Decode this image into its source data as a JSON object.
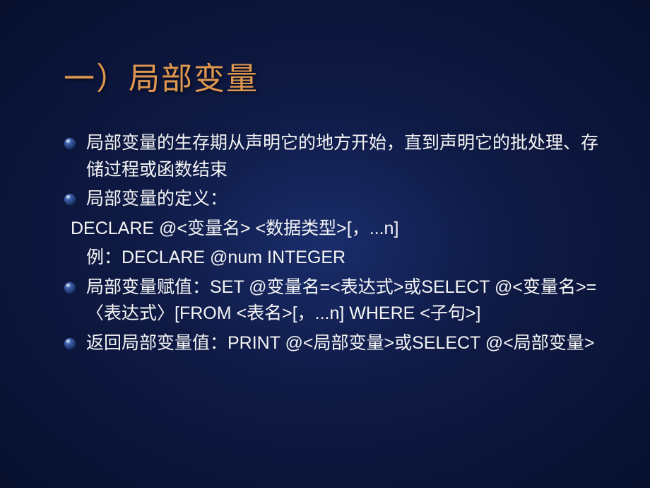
{
  "title": "一）局部变量",
  "bullets": [
    {
      "text": "局部变量的生存期从声明它的地方开始，直到声明它的批处理、存储过程或函数结束",
      "subs": []
    },
    {
      "text": "局部变量的定义：",
      "subs": [
        "DECLARE @<变量名>  <数据类型>[，...n]",
        "例：DECLARE @num INTEGER"
      ],
      "subIndent": true
    },
    {
      "text": "局部变量赋值：SET @变量名=<表达式>或SELECT @<变量名>=〈表达式〉[FROM <表名>[，...n] WHERE <子句>]",
      "subs": []
    },
    {
      "text": "返回局部变量值：PRINT @<局部变量>或SELECT @<局部变量>",
      "subs": []
    }
  ]
}
